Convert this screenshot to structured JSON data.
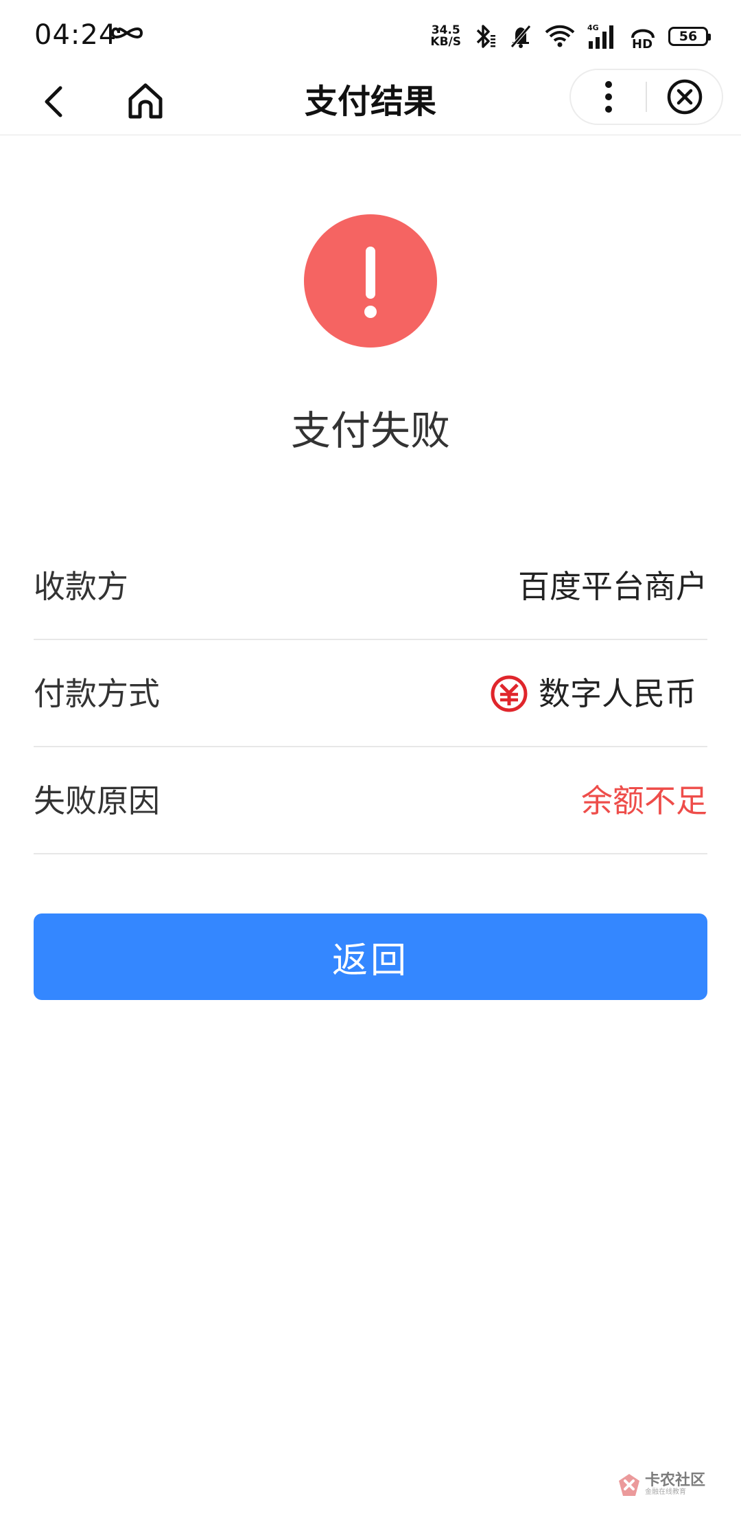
{
  "status_bar": {
    "time": "04:24",
    "net_speed_value": "34.5",
    "net_speed_unit": "KB/S",
    "battery": "56",
    "icons": [
      "infinity-icon",
      "bluetooth-icon",
      "mute-icon",
      "wifi-icon",
      "signal-4g-icon",
      "hd-icon",
      "battery-icon"
    ]
  },
  "nav": {
    "title": "支付结果",
    "icons": [
      "back-icon",
      "home-icon",
      "more-icon",
      "close-icon"
    ]
  },
  "result": {
    "title": "支付失败",
    "icon": "exclamation-icon",
    "icon_color": "#f56462"
  },
  "details": {
    "payee_label": "收款方",
    "payee_value": "百度平台商户",
    "method_label": "付款方式",
    "method_value": "数字人民币",
    "method_icon": "digital-rmb-icon",
    "reason_label": "失败原因",
    "reason_value": "余额不足",
    "reason_color": "#ee4d4a"
  },
  "actions": {
    "return_label": "返回",
    "button_color": "#3487ff"
  },
  "watermark": {
    "main": "卡农社区",
    "sub": "金融在线教育"
  }
}
